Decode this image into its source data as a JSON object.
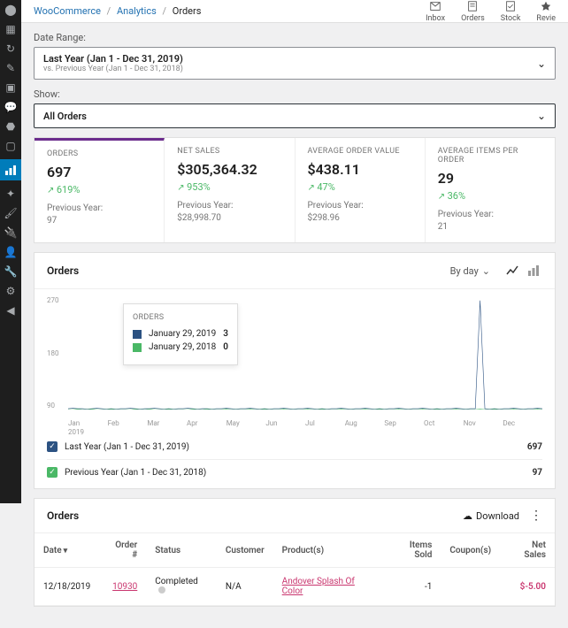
{
  "breadcrumb": {
    "root": "WooCommerce",
    "mid": "Analytics",
    "leaf": "Orders"
  },
  "topbar": [
    {
      "name": "inbox",
      "label": "Inbox"
    },
    {
      "name": "orders",
      "label": "Orders"
    },
    {
      "name": "stock",
      "label": "Stock"
    },
    {
      "name": "reviews",
      "label": "Revie"
    }
  ],
  "filters": {
    "date_label": "Date Range:",
    "date_title": "Last Year (Jan 1 - Dec 31, 2019)",
    "date_sub": "vs. Previous Year (Jan 1 - Dec 31, 2018)",
    "show_label": "Show:",
    "show_value": "All Orders"
  },
  "stats": [
    {
      "id": "orders",
      "label": "ORDERS",
      "value": "697",
      "delta": "619%",
      "py_label": "Previous Year:",
      "py": "97",
      "selected": true
    },
    {
      "id": "netsales",
      "label": "NET SALES",
      "value": "$305,364.32",
      "delta": "953%",
      "py_label": "Previous Year:",
      "py": "$28,998.70"
    },
    {
      "id": "aov",
      "label": "AVERAGE ORDER VALUE",
      "value": "$438.11",
      "delta": "47%",
      "py_label": "Previous Year:",
      "py": "$298.96"
    },
    {
      "id": "aipo",
      "label": "AVERAGE ITEMS PER ORDER",
      "value": "29",
      "delta": "36%",
      "py_label": "Previous Year:",
      "py": "21"
    }
  ],
  "chart": {
    "title": "Orders",
    "by": "By day",
    "tooltip": {
      "title": "ORDERS",
      "rows": [
        {
          "color": "a",
          "label": "January 29, 2019",
          "val": "3"
        },
        {
          "color": "b",
          "label": "January 29, 2018",
          "val": "0"
        }
      ]
    },
    "legend": [
      {
        "color": "a",
        "label": "Last Year (Jan 1 - Dec 31, 2019)",
        "val": "697"
      },
      {
        "color": "b",
        "label": "Previous Year (Jan 1 - Dec 31, 2018)",
        "val": "97"
      }
    ]
  },
  "chart_data": {
    "type": "line",
    "title": "Orders",
    "xlabel": "2019",
    "ylabel": "",
    "ylim": [
      0,
      270
    ],
    "yticks": [
      270,
      180,
      90
    ],
    "xticks": [
      "Jan",
      "Feb",
      "Mar",
      "Apr",
      "May",
      "Jun",
      "Jul",
      "Aug",
      "Sep",
      "Oct",
      "Nov",
      "Dec"
    ],
    "series": [
      {
        "name": "Last Year (Jan 1 - Dec 31, 2019)",
        "color": "#2c5282",
        "values": [
          2,
          3,
          2,
          2,
          1,
          2,
          3,
          2,
          1,
          2,
          1,
          2,
          2,
          3,
          2,
          1,
          2,
          2,
          3,
          2,
          1,
          2,
          1,
          2,
          2,
          3,
          2,
          1,
          2,
          2,
          1,
          2,
          2,
          3,
          2,
          1,
          2,
          2,
          3,
          2,
          1,
          2,
          1,
          2,
          2,
          3,
          2,
          1,
          2,
          2,
          3,
          2,
          1,
          2,
          1,
          2,
          2,
          3,
          2,
          1,
          2,
          2,
          3,
          2,
          1,
          2,
          1,
          2,
          2,
          3,
          2,
          1,
          2,
          2,
          3,
          2,
          1,
          2,
          1,
          2,
          2,
          3,
          2,
          1,
          2,
          2,
          260,
          2,
          1,
          2,
          1,
          2,
          2,
          3,
          2,
          1,
          2,
          2,
          3,
          2
        ]
      },
      {
        "name": "Previous Year (Jan 1 - Dec 31, 2018)",
        "color": "#4ab866",
        "values": [
          0,
          0,
          1,
          0,
          0,
          1,
          0,
          0,
          0,
          1,
          0,
          0,
          0,
          0,
          1,
          0,
          0,
          1,
          0,
          0,
          0,
          1,
          0,
          0,
          0,
          0,
          1,
          0,
          0,
          1,
          0,
          0,
          0,
          1,
          0,
          0,
          0,
          0,
          1,
          0,
          0,
          1,
          0,
          0,
          0,
          1,
          0,
          0,
          0,
          0,
          1,
          0,
          0,
          1,
          0,
          0,
          0,
          1,
          0,
          0,
          0,
          0,
          1,
          0,
          0,
          1,
          0,
          0,
          0,
          1,
          0,
          0,
          0,
          0,
          1,
          0,
          0,
          1,
          0,
          0,
          0,
          1,
          0,
          0,
          0,
          0,
          1,
          0,
          0,
          1,
          0,
          0,
          0,
          1,
          0,
          0,
          0,
          0,
          1,
          0
        ]
      }
    ],
    "selected_point": {
      "x_index": 8,
      "values": [
        3,
        0
      ],
      "labels": [
        "January 29, 2019",
        "January 29, 2018"
      ]
    }
  },
  "table": {
    "title": "Orders",
    "download": "Download",
    "columns": [
      "Date",
      "Order #",
      "Status",
      "Customer",
      "Product(s)",
      "Items Sold",
      "Coupon(s)",
      "Net Sales"
    ],
    "rows": [
      {
        "date": "12/18/2019",
        "order": "10930",
        "status": "Completed",
        "customer": "N/A",
        "product": "Andover Splash Of Color",
        "items": "-1",
        "coupons": "",
        "net": "$-5.00"
      }
    ]
  }
}
